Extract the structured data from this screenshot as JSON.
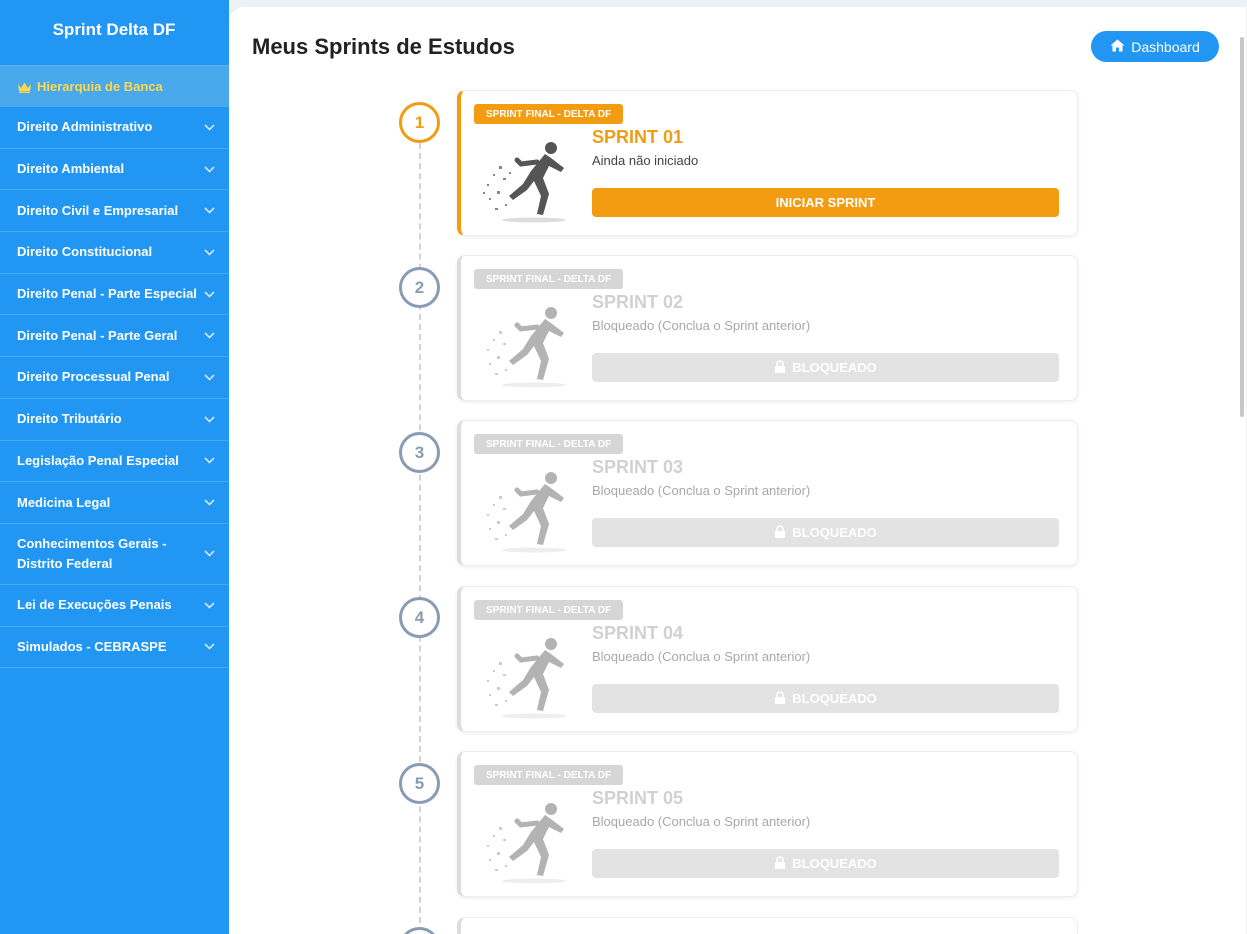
{
  "sidebar": {
    "title": "Sprint Delta DF",
    "hierarchy_label": "Hierarquia de Banca",
    "hierarchy_icon": "crown-icon",
    "items": [
      {
        "label": "Direito Administrativo"
      },
      {
        "label": "Direito Ambiental"
      },
      {
        "label": "Direito Civil e Empresarial"
      },
      {
        "label": "Direito Constitucional"
      },
      {
        "label": "Direito Penal - Parte Especial"
      },
      {
        "label": "Direito Penal - Parte Geral"
      },
      {
        "label": "Direito Processual Penal"
      },
      {
        "label": "Direito Tributário"
      },
      {
        "label": "Legislação Penal Especial"
      },
      {
        "label": "Medicina Legal"
      },
      {
        "label": "Conhecimentos Gerais - Distrito Federal"
      },
      {
        "label": "Lei de Execuções Penais"
      },
      {
        "label": "Simulados - CEBRASPE"
      }
    ]
  },
  "header": {
    "title": "Meus Sprints de Estudos",
    "dashboard_label": "Dashboard"
  },
  "sprints": [
    {
      "number": "1",
      "badge": "SPRINT FINAL - DELTA DF",
      "title": "SPRINT 01",
      "status": "Ainda não iniciado",
      "action": "INICIAR SPRINT",
      "locked": false
    },
    {
      "number": "2",
      "badge": "SPRINT FINAL - DELTA DF",
      "title": "SPRINT 02",
      "status": "Bloqueado (Conclua o Sprint anterior)",
      "action": "BLOQUEADO",
      "locked": true
    },
    {
      "number": "3",
      "badge": "SPRINT FINAL - DELTA DF",
      "title": "SPRINT 03",
      "status": "Bloqueado (Conclua o Sprint anterior)",
      "action": "BLOQUEADO",
      "locked": true
    },
    {
      "number": "4",
      "badge": "SPRINT FINAL - DELTA DF",
      "title": "SPRINT 04",
      "status": "Bloqueado (Conclua o Sprint anterior)",
      "action": "BLOQUEADO",
      "locked": true
    },
    {
      "number": "5",
      "badge": "SPRINT FINAL - DELTA DF",
      "title": "SPRINT 05",
      "status": "Bloqueado (Conclua o Sprint anterior)",
      "action": "BLOQUEADO",
      "locked": true
    }
  ],
  "colors": {
    "primary": "#2196f3",
    "accent": "#f39c12",
    "hierarchy": "#ffd84a",
    "locked": "#e3e3e3"
  }
}
